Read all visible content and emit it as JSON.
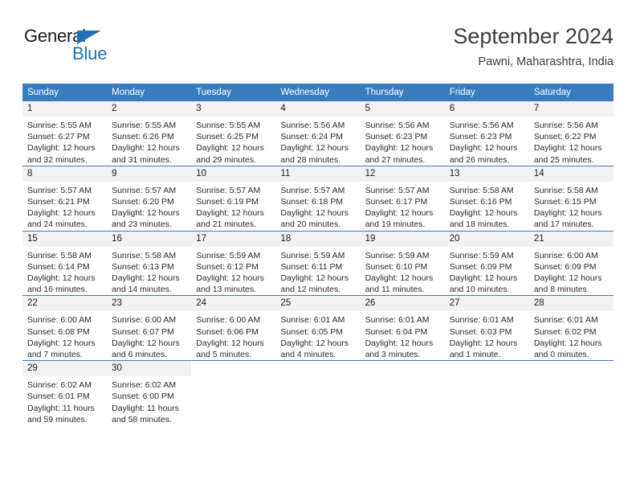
{
  "brand": {
    "name_top": "General",
    "name_bottom": "Blue",
    "triangle_color": "#1f72b8"
  },
  "header": {
    "title": "September 2024",
    "subtitle": "Pawni, Maharashtra, India"
  },
  "theme": {
    "header_bg": "#3a7dbf",
    "daynum_bg": "#f2f2f2",
    "row_divider": "#3a7dbf",
    "text": "#2a2a2a"
  },
  "labels": {
    "sunrise_prefix": "Sunrise:",
    "sunset_prefix": "Sunset:",
    "daylight_prefix": "Daylight:"
  },
  "weekdays": [
    "Sunday",
    "Monday",
    "Tuesday",
    "Wednesday",
    "Thursday",
    "Friday",
    "Saturday"
  ],
  "weeks": [
    [
      {
        "day": "1",
        "sunrise": "Sunrise: 5:55 AM",
        "sunset": "Sunset: 6:27 PM",
        "daylight": "Daylight: 12 hours and 32 minutes."
      },
      {
        "day": "2",
        "sunrise": "Sunrise: 5:55 AM",
        "sunset": "Sunset: 6:26 PM",
        "daylight": "Daylight: 12 hours and 31 minutes."
      },
      {
        "day": "3",
        "sunrise": "Sunrise: 5:55 AM",
        "sunset": "Sunset: 6:25 PM",
        "daylight": "Daylight: 12 hours and 29 minutes."
      },
      {
        "day": "4",
        "sunrise": "Sunrise: 5:56 AM",
        "sunset": "Sunset: 6:24 PM",
        "daylight": "Daylight: 12 hours and 28 minutes."
      },
      {
        "day": "5",
        "sunrise": "Sunrise: 5:56 AM",
        "sunset": "Sunset: 6:23 PM",
        "daylight": "Daylight: 12 hours and 27 minutes."
      },
      {
        "day": "6",
        "sunrise": "Sunrise: 5:56 AM",
        "sunset": "Sunset: 6:23 PM",
        "daylight": "Daylight: 12 hours and 26 minutes."
      },
      {
        "day": "7",
        "sunrise": "Sunrise: 5:56 AM",
        "sunset": "Sunset: 6:22 PM",
        "daylight": "Daylight: 12 hours and 25 minutes."
      }
    ],
    [
      {
        "day": "8",
        "sunrise": "Sunrise: 5:57 AM",
        "sunset": "Sunset: 6:21 PM",
        "daylight": "Daylight: 12 hours and 24 minutes."
      },
      {
        "day": "9",
        "sunrise": "Sunrise: 5:57 AM",
        "sunset": "Sunset: 6:20 PM",
        "daylight": "Daylight: 12 hours and 23 minutes."
      },
      {
        "day": "10",
        "sunrise": "Sunrise: 5:57 AM",
        "sunset": "Sunset: 6:19 PM",
        "daylight": "Daylight: 12 hours and 21 minutes."
      },
      {
        "day": "11",
        "sunrise": "Sunrise: 5:57 AM",
        "sunset": "Sunset: 6:18 PM",
        "daylight": "Daylight: 12 hours and 20 minutes."
      },
      {
        "day": "12",
        "sunrise": "Sunrise: 5:57 AM",
        "sunset": "Sunset: 6:17 PM",
        "daylight": "Daylight: 12 hours and 19 minutes."
      },
      {
        "day": "13",
        "sunrise": "Sunrise: 5:58 AM",
        "sunset": "Sunset: 6:16 PM",
        "daylight": "Daylight: 12 hours and 18 minutes."
      },
      {
        "day": "14",
        "sunrise": "Sunrise: 5:58 AM",
        "sunset": "Sunset: 6:15 PM",
        "daylight": "Daylight: 12 hours and 17 minutes."
      }
    ],
    [
      {
        "day": "15",
        "sunrise": "Sunrise: 5:58 AM",
        "sunset": "Sunset: 6:14 PM",
        "daylight": "Daylight: 12 hours and 16 minutes."
      },
      {
        "day": "16",
        "sunrise": "Sunrise: 5:58 AM",
        "sunset": "Sunset: 6:13 PM",
        "daylight": "Daylight: 12 hours and 14 minutes."
      },
      {
        "day": "17",
        "sunrise": "Sunrise: 5:59 AM",
        "sunset": "Sunset: 6:12 PM",
        "daylight": "Daylight: 12 hours and 13 minutes."
      },
      {
        "day": "18",
        "sunrise": "Sunrise: 5:59 AM",
        "sunset": "Sunset: 6:11 PM",
        "daylight": "Daylight: 12 hours and 12 minutes."
      },
      {
        "day": "19",
        "sunrise": "Sunrise: 5:59 AM",
        "sunset": "Sunset: 6:10 PM",
        "daylight": "Daylight: 12 hours and 11 minutes."
      },
      {
        "day": "20",
        "sunrise": "Sunrise: 5:59 AM",
        "sunset": "Sunset: 6:09 PM",
        "daylight": "Daylight: 12 hours and 10 minutes."
      },
      {
        "day": "21",
        "sunrise": "Sunrise: 6:00 AM",
        "sunset": "Sunset: 6:09 PM",
        "daylight": "Daylight: 12 hours and 8 minutes."
      }
    ],
    [
      {
        "day": "22",
        "sunrise": "Sunrise: 6:00 AM",
        "sunset": "Sunset: 6:08 PM",
        "daylight": "Daylight: 12 hours and 7 minutes."
      },
      {
        "day": "23",
        "sunrise": "Sunrise: 6:00 AM",
        "sunset": "Sunset: 6:07 PM",
        "daylight": "Daylight: 12 hours and 6 minutes."
      },
      {
        "day": "24",
        "sunrise": "Sunrise: 6:00 AM",
        "sunset": "Sunset: 6:06 PM",
        "daylight": "Daylight: 12 hours and 5 minutes."
      },
      {
        "day": "25",
        "sunrise": "Sunrise: 6:01 AM",
        "sunset": "Sunset: 6:05 PM",
        "daylight": "Daylight: 12 hours and 4 minutes."
      },
      {
        "day": "26",
        "sunrise": "Sunrise: 6:01 AM",
        "sunset": "Sunset: 6:04 PM",
        "daylight": "Daylight: 12 hours and 3 minutes."
      },
      {
        "day": "27",
        "sunrise": "Sunrise: 6:01 AM",
        "sunset": "Sunset: 6:03 PM",
        "daylight": "Daylight: 12 hours and 1 minute."
      },
      {
        "day": "28",
        "sunrise": "Sunrise: 6:01 AM",
        "sunset": "Sunset: 6:02 PM",
        "daylight": "Daylight: 12 hours and 0 minutes."
      }
    ],
    [
      {
        "day": "29",
        "sunrise": "Sunrise: 6:02 AM",
        "sunset": "Sunset: 6:01 PM",
        "daylight": "Daylight: 11 hours and 59 minutes."
      },
      {
        "day": "30",
        "sunrise": "Sunrise: 6:02 AM",
        "sunset": "Sunset: 6:00 PM",
        "daylight": "Daylight: 11 hours and 58 minutes."
      },
      {
        "day": "",
        "sunrise": "",
        "sunset": "",
        "daylight": ""
      },
      {
        "day": "",
        "sunrise": "",
        "sunset": "",
        "daylight": ""
      },
      {
        "day": "",
        "sunrise": "",
        "sunset": "",
        "daylight": ""
      },
      {
        "day": "",
        "sunrise": "",
        "sunset": "",
        "daylight": ""
      },
      {
        "day": "",
        "sunrise": "",
        "sunset": "",
        "daylight": ""
      }
    ]
  ]
}
